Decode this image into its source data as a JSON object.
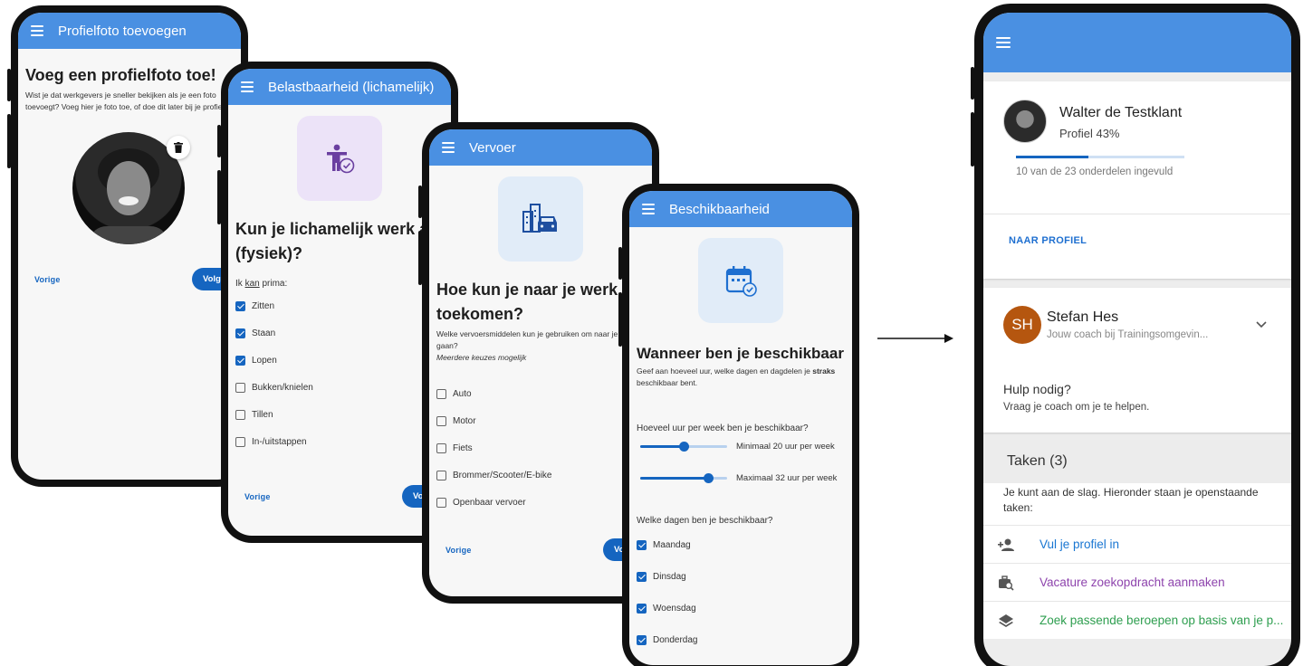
{
  "phone1": {
    "title": "Profielfoto toevoegen",
    "heading": "Voeg een profielfoto toe!",
    "text": "Wist je dat werkgevers je sneller bekijken als je een foto toevoegt? Voeg hier je foto toe, of doe dit later bij je profiel.",
    "prev": "Vorige",
    "next": "Volgende"
  },
  "phone2": {
    "title": "Belastbaarheid (lichamelijk)",
    "heading_line1": "Kun je lichamelijk werk aan",
    "heading_line2": "(fysiek)?",
    "intro_pre": "Ik ",
    "intro_underlined": "kan",
    "intro_post": " prima:",
    "options": [
      {
        "label": "Zitten",
        "checked": true
      },
      {
        "label": "Staan",
        "checked": true
      },
      {
        "label": "Lopen",
        "checked": true
      },
      {
        "label": "Bukken/knielen",
        "checked": false
      },
      {
        "label": "Tillen",
        "checked": false
      },
      {
        "label": "In-/uitstappen",
        "checked": false
      }
    ],
    "prev": "Vorige",
    "next": "Volgende"
  },
  "phone3": {
    "title": "Vervoer",
    "heading_line1": "Hoe kun je naar je werk",
    "heading_line2": "toekomen?",
    "text": "Welke vervoersmiddelen kun je gebruiken om naar je werk te gaan?",
    "note": "Meerdere keuzes mogelijk",
    "options": [
      {
        "label": "Auto",
        "checked": false
      },
      {
        "label": "Motor",
        "checked": false
      },
      {
        "label": "Fiets",
        "checked": false
      },
      {
        "label": "Brommer/Scooter/E-bike",
        "checked": false
      },
      {
        "label": "Openbaar vervoer",
        "checked": false
      }
    ],
    "prev": "Vorige",
    "next": "Volgende"
  },
  "phone4": {
    "title": "Beschikbaarheid",
    "heading": "Wanneer ben je beschikbaar",
    "text_pre": "Geef aan hoeveel uur, welke dagen en dagdelen je ",
    "text_bold": "straks",
    "text_post": " beschikbaar bent.",
    "hours_question": "Hoeveel uur per week ben je beschikbaar?",
    "min_label": "Minimaal 20 uur per week",
    "min_fraction": 0.5,
    "max_label": "Maximaal 32 uur per week",
    "max_fraction": 0.78,
    "days_question": "Welke dagen ben je beschikbaar?",
    "days": [
      {
        "label": "Maandag",
        "checked": true
      },
      {
        "label": "Dinsdag",
        "checked": true
      },
      {
        "label": "Woensdag",
        "checked": true
      },
      {
        "label": "Donderdag",
        "checked": true
      }
    ]
  },
  "dashboard": {
    "user_name": "Walter de Testklant",
    "profile_label": "Profiel 43%",
    "profile_progress": 0.43,
    "progress_text": "10 van de 23 onderdelen ingevuld",
    "profile_link": "NAAR PROFIEL",
    "coach_initials": "SH",
    "coach_name": "Stefan Hes",
    "coach_subtitle": "Jouw coach bij Trainingsomgevin...",
    "help_title": "Hulp nodig?",
    "help_text": "Vraag je coach om je te helpen.",
    "tasks_title": "Taken (3)",
    "tasks_text": "Je kunt aan de slag. Hieronder staan je openstaande taken:",
    "tasks": [
      {
        "label": "Vul je profiel in",
        "icon": "person-add-icon",
        "color": "#1976d2"
      },
      {
        "label": "Vacature zoekopdracht aanmaken",
        "icon": "work-search-icon",
        "color": "#8e44ad"
      },
      {
        "label": "Zoek passende beroepen op basis van je p...",
        "icon": "layers-icon",
        "color": "#2e9e4f"
      }
    ]
  },
  "colors": {
    "appbar": "#4a90e2",
    "primary": "#1565c0",
    "avatar_coach": "#b5560f"
  }
}
